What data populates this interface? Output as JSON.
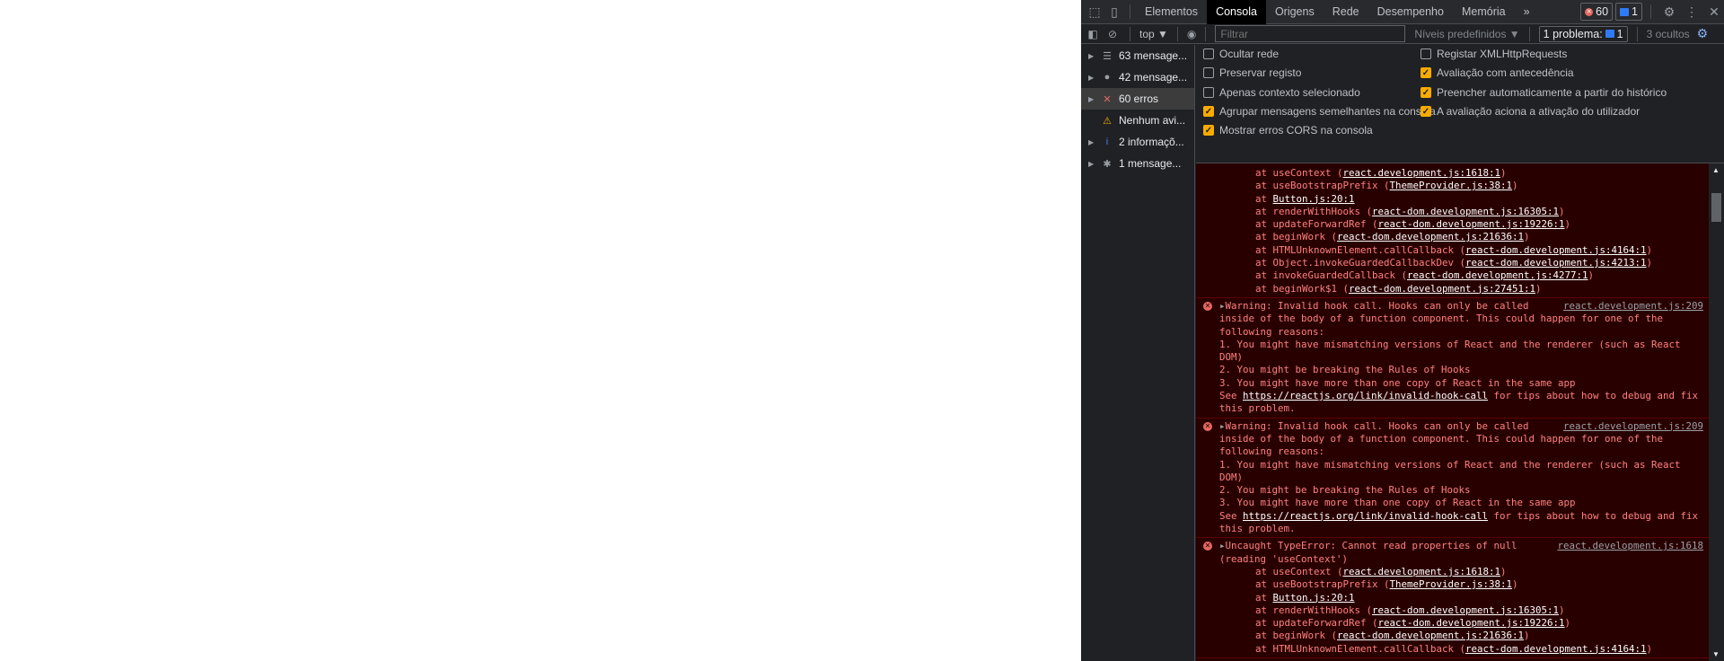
{
  "devtools": {
    "tabs": [
      "Elementos",
      "Consola",
      "Origens",
      "Rede",
      "Desempenho",
      "Memória"
    ],
    "active_tab": "Consola",
    "more_tabs": "»",
    "error_count": "60",
    "message_count": "1",
    "toolbar": {
      "context": "top ▼",
      "filter_placeholder": "Filtrar",
      "levels": "Níveis predefinidos ▼",
      "problems": "1 problema:",
      "problems_count": "1",
      "hidden": "3 ocultos"
    },
    "sidebar": [
      {
        "label": "63 mensage...",
        "icon": "list-icon",
        "expandable": true,
        "selected": false
      },
      {
        "label": "42 mensage...",
        "icon": "user-icon",
        "expandable": true,
        "selected": false
      },
      {
        "label": "60 erros",
        "icon": "error-icon",
        "expandable": true,
        "selected": true
      },
      {
        "label": "Nenhum avi...",
        "icon": "warning-icon",
        "expandable": false,
        "selected": false
      },
      {
        "label": "2 informaçõ...",
        "icon": "info-icon",
        "expandable": true,
        "selected": false
      },
      {
        "label": "1 mensage...",
        "icon": "bug-icon",
        "expandable": true,
        "selected": false
      }
    ],
    "settings": [
      {
        "label": "Ocultar rede",
        "checked": false
      },
      {
        "label": "Preservar registo",
        "checked": false
      },
      {
        "label": "Apenas contexto selecionado",
        "checked": false
      },
      {
        "label": "Agrupar mensagens semelhantes na consola",
        "checked": true
      },
      {
        "label": "Mostrar erros CORS na consola",
        "checked": true
      },
      {
        "label": "Registar XMLHttpRequests",
        "checked": false
      },
      {
        "label": "Avaliação com antecedência",
        "checked": true
      },
      {
        "label": "Preencher automaticamente a partir do histórico",
        "checked": true
      },
      {
        "label": "A avaliação aciona a ativação do utilizador",
        "checked": true
      }
    ],
    "colors": {
      "error_bg": "#290000",
      "error_text": "#ff8080",
      "checkbox": "#f9ab00"
    },
    "messages": [
      {
        "stack": [
          [
            "at useContext (",
            "react.development.js:1618:1",
            ")"
          ],
          [
            "at useBootstrapPrefix (",
            "ThemeProvider.js:38:1",
            ")"
          ],
          [
            "at ",
            "Button.js:20:1",
            ""
          ],
          [
            "at renderWithHooks (",
            "react-dom.development.js:16305:1",
            ")"
          ],
          [
            "at updateForwardRef (",
            "react-dom.development.js:19226:1",
            ")"
          ],
          [
            "at beginWork (",
            "react-dom.development.js:21636:1",
            ")"
          ],
          [
            "at HTMLUnknownElement.callCallback (",
            "react-dom.development.js:4164:1",
            ")"
          ],
          [
            "at Object.invokeGuardedCallbackDev (",
            "react-dom.development.js:4213:1",
            ")"
          ],
          [
            "at invokeGuardedCallback (",
            "react-dom.development.js:4277:1",
            ")"
          ],
          [
            "at beginWork$1 (",
            "react-dom.development.js:27451:1",
            ")"
          ]
        ]
      },
      {
        "source": "react.development.js:209",
        "text": "Warning: Invalid hook call. Hooks can only be called inside of the body of a function component. This could happen for one of the following reasons:\n1. You might have mismatching versions of React and the renderer (such as React DOM)\n2. You might be breaking the Rules of Hooks\n3. You might have more than one copy of React in the same app\nSee ",
        "link": "https://reactjs.org/link/invalid-hook-call",
        "after": " for tips about how to debug and fix this problem."
      },
      {
        "source": "react.development.js:209",
        "text": "Warning: Invalid hook call. Hooks can only be called inside of the body of a function component. This could happen for one of the following reasons:\n1. You might have mismatching versions of React and the renderer (such as React DOM)\n2. You might be breaking the Rules of Hooks\n3. You might have more than one copy of React in the same app\nSee ",
        "link": "https://reactjs.org/link/invalid-hook-call",
        "after": " for tips about how to debug and fix this problem."
      },
      {
        "source": "react.development.js:1618",
        "text": "Uncaught TypeError: Cannot read properties of null (reading 'useContext')",
        "stack": [
          [
            "at useContext (",
            "react.development.js:1618:1",
            ")"
          ],
          [
            "at useBootstrapPrefix (",
            "ThemeProvider.js:38:1",
            ")"
          ],
          [
            "at ",
            "Button.js:20:1",
            ""
          ],
          [
            "at renderWithHooks (",
            "react-dom.development.js:16305:1",
            ")"
          ],
          [
            "at updateForwardRef (",
            "react-dom.development.js:19226:1",
            ")"
          ],
          [
            "at beginWork (",
            "react-dom.development.js:21636:1",
            ")"
          ],
          [
            "at HTMLUnknownElement.callCallback (",
            "react-dom.development.js:4164:1",
            ")"
          ]
        ]
      }
    ]
  }
}
